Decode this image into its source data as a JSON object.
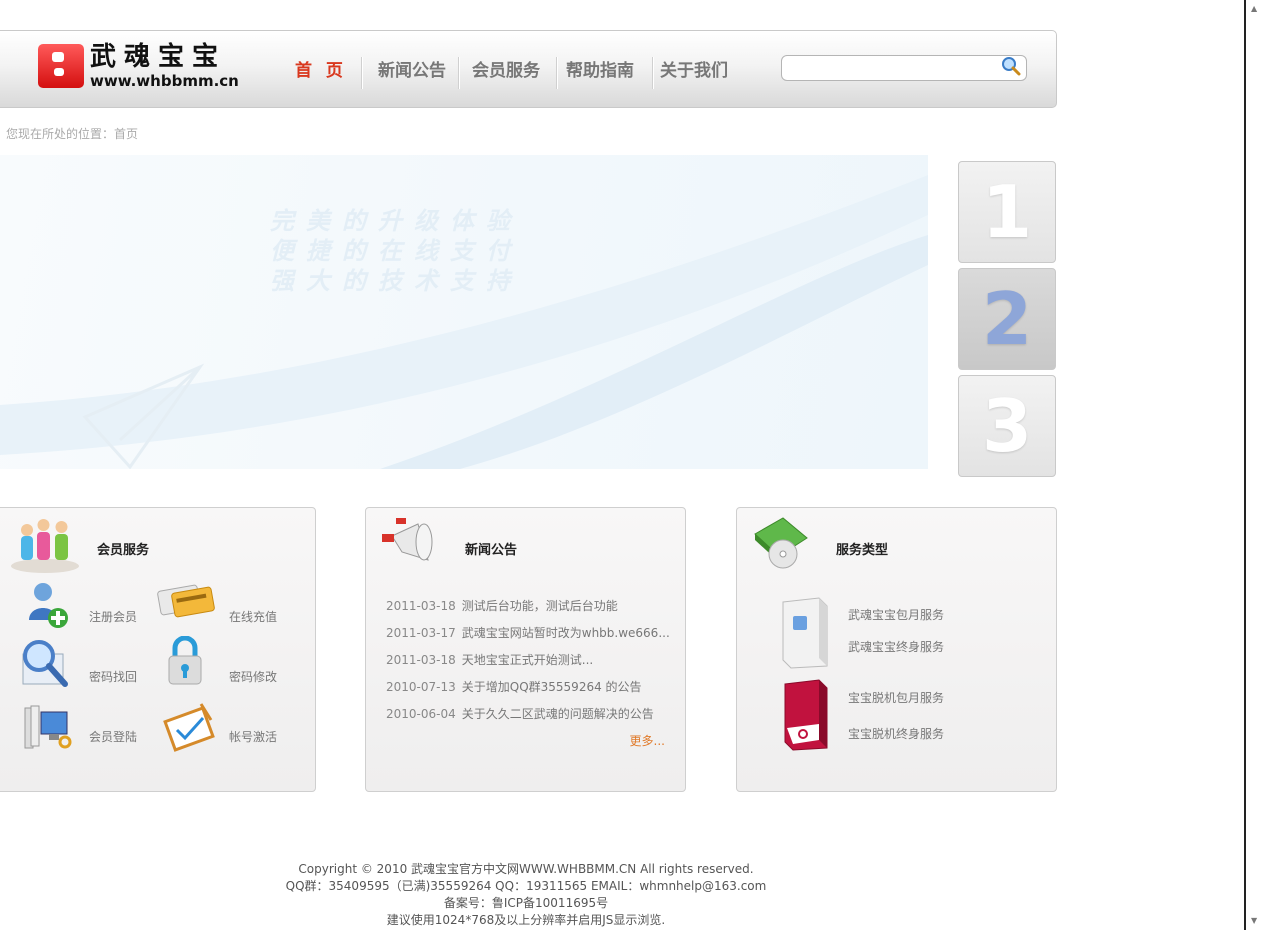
{
  "header": {
    "logo_title": "武魂宝宝",
    "logo_url": "www.whbbmm.cn",
    "nav": [
      "首 页",
      "新闻公告",
      "会员服务",
      "帮助指南",
      "关于我们"
    ],
    "search_value": ""
  },
  "breadcrumb": "您现在所处的位置：首页",
  "banner": {
    "lines": [
      "完美的升级体验",
      "便捷的在线支付",
      "强大的技术支持"
    ],
    "slides": [
      "1",
      "2",
      "3"
    ],
    "active_slide": 2
  },
  "member_panel": {
    "title": "会员服务",
    "items": [
      "注册会员",
      "在线充值",
      "密码找回",
      "密码修改",
      "会员登陆",
      "帐号激活"
    ]
  },
  "news_panel": {
    "title": "新闻公告",
    "items": [
      {
        "date": "2011-03-18",
        "text": "测试后台功能，测试后台功能"
      },
      {
        "date": "2011-03-17",
        "text": "武魂宝宝网站暂时改为whbb.we666..."
      },
      {
        "date": "2011-03-18",
        "text": "天地宝宝正式开始测试..."
      },
      {
        "date": "2010-07-13",
        "text": "关于增加QQ群35559264 的公告"
      },
      {
        "date": "2010-06-04",
        "text": "关于久久二区武魂的问题解决的公告"
      }
    ],
    "more": "更多..."
  },
  "service_panel": {
    "title": "服务类型",
    "items": [
      "武魂宝宝包月服务",
      "武魂宝宝终身服务",
      "宝宝脱机包月服务",
      "宝宝脱机终身服务"
    ]
  },
  "footer": {
    "lines": [
      "Copyright © 2010 武魂宝宝官方中文网WWW.WHBBMM.CN All rights reserved.",
      "QQ群：35409595（已满)35559264 QQ：19311565 EMAIL：whmnhelp@163.com",
      "备案号：鲁ICP备10011695号",
      "建议使用1024*768及以上分辨率并启用JS显示浏览."
    ]
  },
  "colors": {
    "nav_active": "#d9381e",
    "more_link": "#e07a2a",
    "slide_active_digit": "#8ea6d8"
  }
}
